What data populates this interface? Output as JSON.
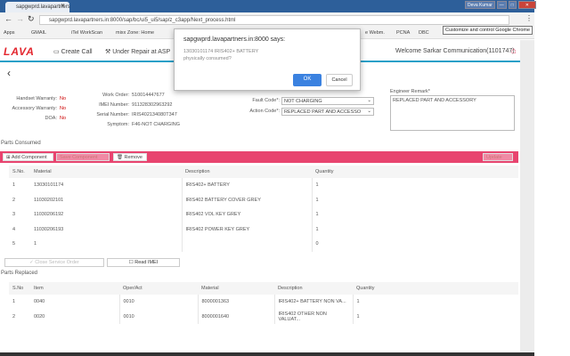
{
  "browser": {
    "tab_title": "sapgwprd.lavapartners",
    "url": "sapgwprd.lavapartners.in:8000/sap/bc/ui5_ui5/sap/z_c3app/Next_process.html",
    "window_user": "Deva Kumar",
    "tooltip": "Customize and control Google Chrome",
    "bookmarks": [
      "Apps",
      "GMAIL",
      "iTel WorkScan",
      "mixx Zone: Home",
      "e Webm.",
      "PCNA",
      "DBC"
    ]
  },
  "header": {
    "logo": "LAVA",
    "nav": [
      "Create Call",
      "Under Repair at ASP"
    ],
    "welcome": "Welcome Sarkar Communication(1101747)"
  },
  "info": {
    "handset_warranty_label": "Handset Warranty:",
    "handset_warranty": "No",
    "accessory_warranty_label": "Accessory Warranty:",
    "accessory_warranty": "No",
    "doa_label": "DOA:",
    "doa": "No",
    "work_order_label": "Work Order:",
    "work_order": "510014447677",
    "imei_label": "IMEI Number:",
    "imei": "911328302963292",
    "serial_label": "Serial Number:",
    "serial": "IRIS402134080T347",
    "symptom_label": "Symptom:",
    "symptom": "F46-NOT CHARGING",
    "fault_code_label": "Fault Code*:",
    "fault_code": "NOT CHARGING",
    "action_code_label": "Action Code*:",
    "action_code": "REPLACED PART AND ACCESSO",
    "remark_label": "Engineer Remark*",
    "remark": "REPLACED PART AND ACCESSORY"
  },
  "consumed": {
    "title": "Parts Consumed",
    "add": "Add Component",
    "save": "Save Component",
    "remove": "Remove",
    "update": "Update",
    "columns": [
      "S.No.",
      "Material",
      "Description",
      "Quantity"
    ],
    "rows": [
      [
        "1",
        "13030101174",
        "IRIS402+ BATTERY",
        "1"
      ],
      [
        "2",
        "11030202101",
        "IRIS402 BATTERY COVER GREY",
        "1"
      ],
      [
        "3",
        "11030206192",
        "IRIS402 VOL KEY GREY",
        "1"
      ],
      [
        "4",
        "11030206193",
        "IRIS402 POWER KEY GREY",
        "1"
      ],
      [
        "5",
        "1",
        "",
        "0"
      ]
    ],
    "close_order": "Close Service Order",
    "read_imei": "Read IMEI"
  },
  "replaced": {
    "title": "Parts Replaced",
    "columns": [
      "S.No",
      "Item",
      "Oper/Act",
      "Material",
      "Description",
      "Quantity"
    ],
    "rows": [
      [
        "1",
        "0040",
        "0010",
        "8000001363",
        "IRIS402+ BATTERY NON VA...",
        "1"
      ],
      [
        "2",
        "0020",
        "0010",
        "8000001640",
        "IRIS402 OTHER NON VALUAT...",
        "1"
      ]
    ]
  },
  "dialog": {
    "title": "sapgwprd.lavapartners.in:8000 says:",
    "message": "13030101174 IRIS402+ BATTERY",
    "question": "physically consumed?",
    "ok": "OK",
    "cancel": "Cancel"
  },
  "colors": {
    "brand": "#e3262e",
    "toolbar": "#e8446f",
    "accent": "#2aa0c8",
    "ok": "#3b82e0"
  }
}
